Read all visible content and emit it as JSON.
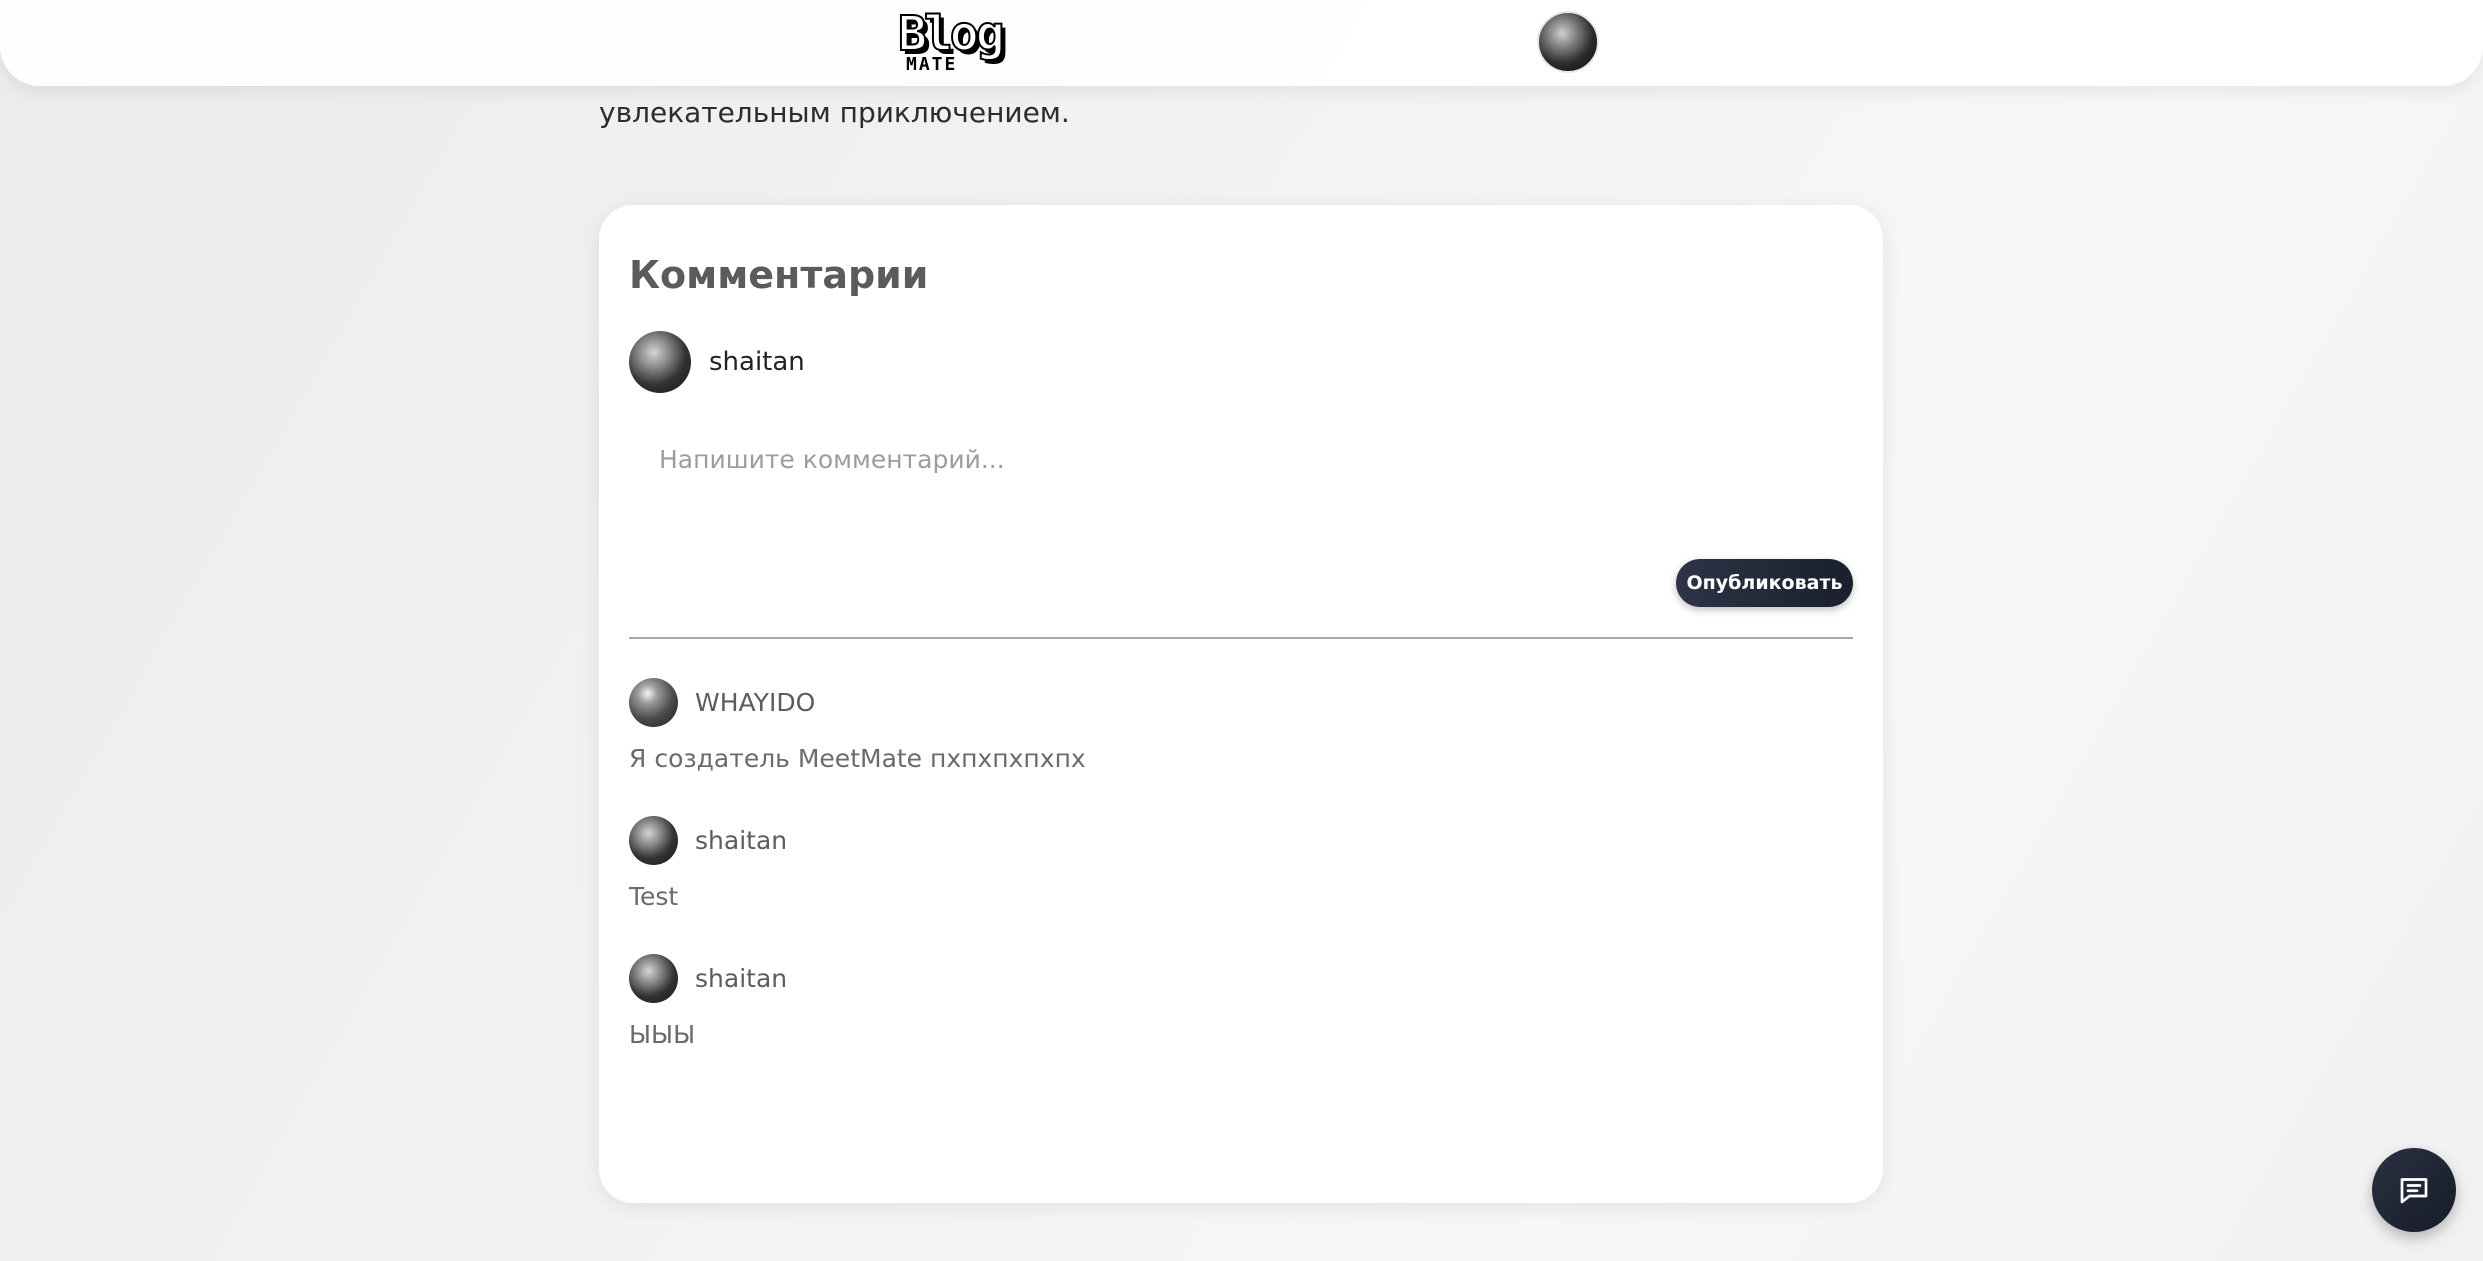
{
  "article": {
    "last_line": "увлекательным приключением."
  },
  "header": {
    "logo_main": "Blog",
    "logo_sub": "MATE"
  },
  "comments": {
    "title": "Комментарии",
    "composer": {
      "user_name": "shaitan",
      "placeholder": "Напишите комментарий...",
      "publish_label": "Опубликовать"
    },
    "items": [
      {
        "author": "WHAYIDO",
        "text": "Я создатель MeetMate пхпхпхпхпх"
      },
      {
        "author": "shaitan",
        "text": "Test"
      },
      {
        "author": "shaitan",
        "text": "ЫЫЫ"
      }
    ]
  },
  "icons": {
    "chat": "chat-bubble-icon"
  }
}
